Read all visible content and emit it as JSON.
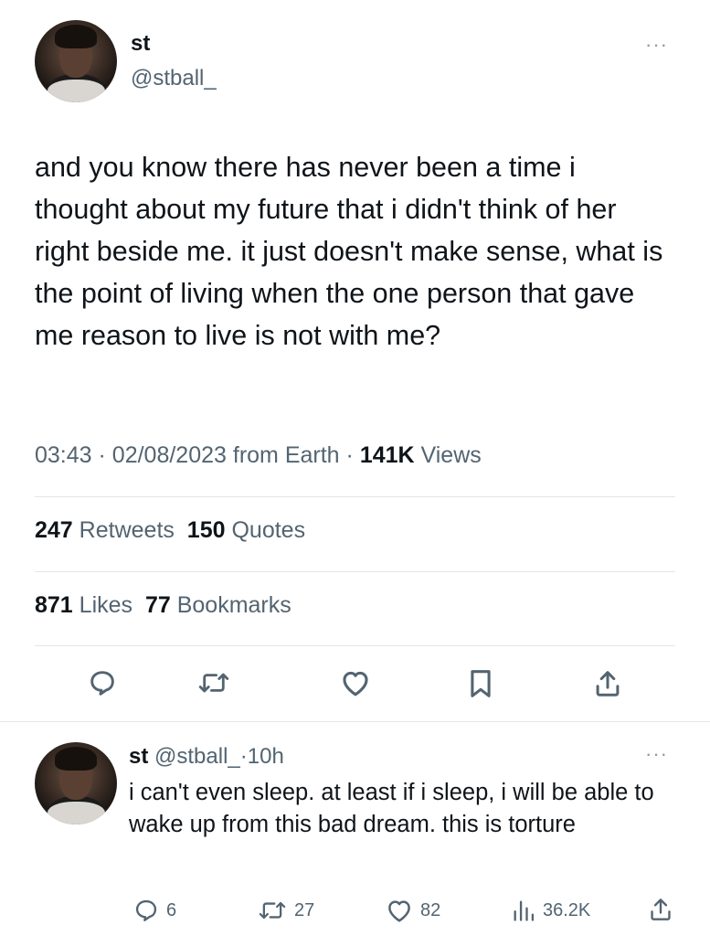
{
  "main_tweet": {
    "author_name": "st",
    "author_handle": "@stball_",
    "more_label": "···",
    "text": "and you know there has never been a time i thought about my future that i didn't think of her right beside me. it just doesn't make sense, what is the point of living when the one person that gave me reason to live is not with me?",
    "time": "03:43",
    "date": "02/08/2023",
    "source": "from Earth",
    "separator": "·",
    "views_count": "141K",
    "views_label": "Views",
    "retweets_count": "247",
    "retweets_label": "Retweets",
    "quotes_count": "150",
    "quotes_label": "Quotes",
    "likes_count": "871",
    "likes_label": "Likes",
    "bookmarks_count": "77",
    "bookmarks_label": "Bookmarks"
  },
  "reply_tweet": {
    "author_name": "st",
    "author_handle": "@stball_",
    "separator": "·",
    "time_ago": "10h",
    "more_label": "···",
    "text": "i can't even sleep. at least if i sleep, i will be able to wake up from this bad dream. this is torture",
    "replies": "6",
    "retweets": "27",
    "likes": "82",
    "views": "36.2K"
  },
  "icons": {
    "reply": "speech-bubble-icon",
    "retweet": "retweet-arrows-icon",
    "like": "heart-icon",
    "bookmark": "bookmark-icon",
    "share": "share-upload-icon",
    "views": "bar-chart-icon"
  },
  "colors": {
    "text_primary": "#0f1419",
    "text_secondary": "#536471",
    "divider": "#e1e6ea",
    "background": "#ffffff"
  }
}
